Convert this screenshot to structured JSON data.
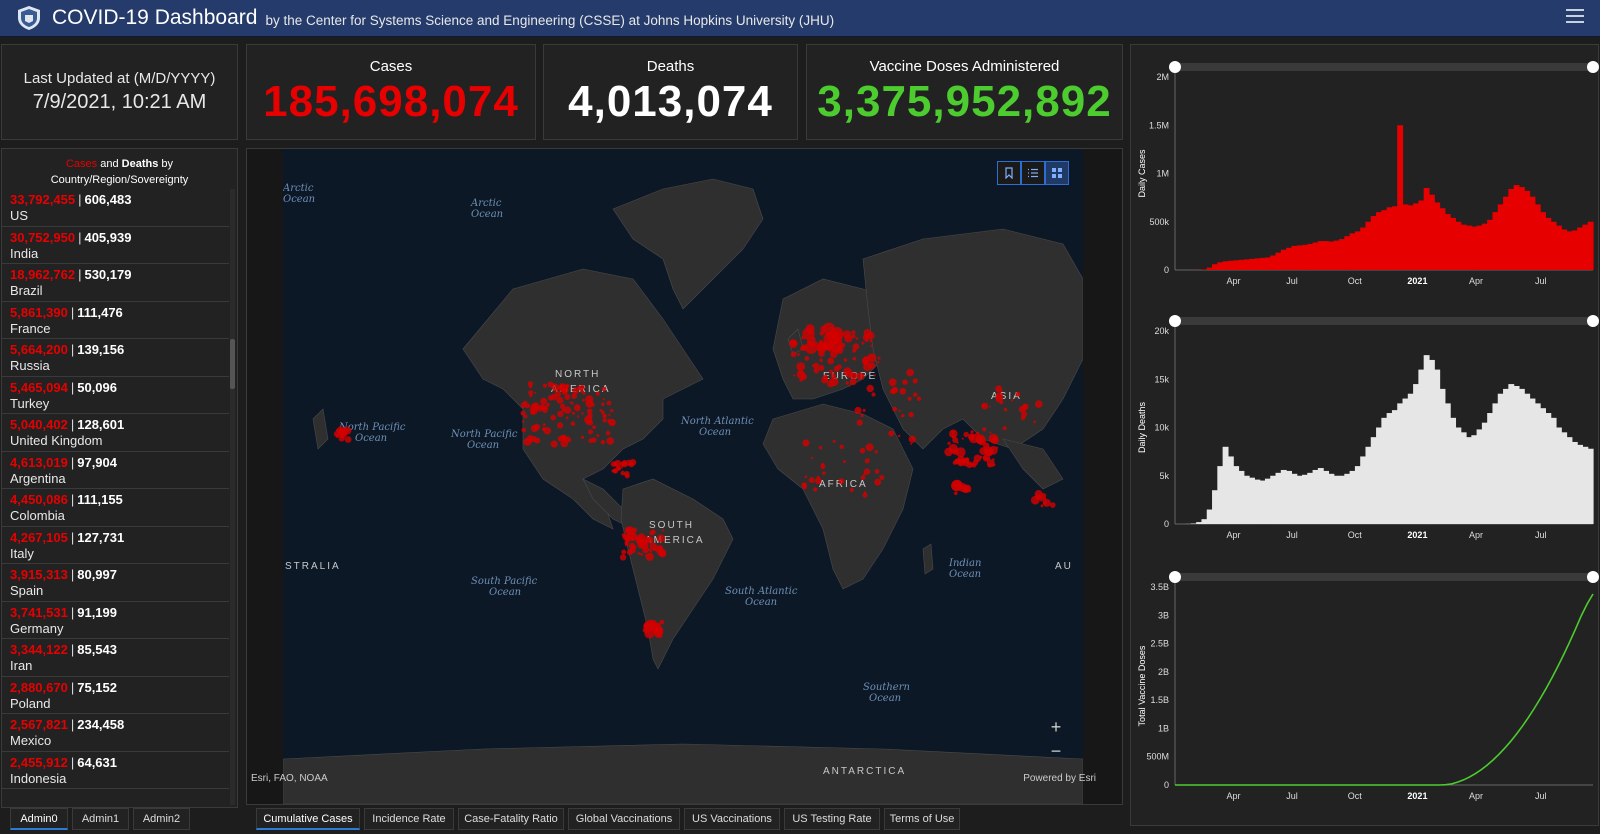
{
  "header": {
    "title": "COVID-19 Dashboard",
    "subtitle": "by the Center for Systems Science and Engineering (CSSE) at Johns Hopkins University (JHU)"
  },
  "last_updated": {
    "label": "Last Updated at (M/D/YYYY)",
    "value": "7/9/2021, 10:21 AM"
  },
  "stats": {
    "cases": {
      "label": "Cases",
      "value": "185,698,074",
      "color": "#e60000"
    },
    "deaths": {
      "label": "Deaths",
      "value": "4,013,074",
      "color": "#ffffff"
    },
    "vaccines": {
      "label": "Vaccine Doses Administered",
      "value": "3,375,952,892",
      "color": "#4ccc2e"
    }
  },
  "list": {
    "title_cases": "Cases",
    "title_and": "and",
    "title_deaths": "Deaths",
    "title_by": "by",
    "title_line2": "Country/Region/Sovereignty",
    "items": [
      {
        "cases": "33,792,455",
        "deaths": "606,483",
        "name": "US"
      },
      {
        "cases": "30,752,950",
        "deaths": "405,939",
        "name": "India"
      },
      {
        "cases": "18,962,762",
        "deaths": "530,179",
        "name": "Brazil"
      },
      {
        "cases": "5,861,390",
        "deaths": "111,476",
        "name": "France"
      },
      {
        "cases": "5,664,200",
        "deaths": "139,156",
        "name": "Russia"
      },
      {
        "cases": "5,465,094",
        "deaths": "50,096",
        "name": "Turkey"
      },
      {
        "cases": "5,040,402",
        "deaths": "128,601",
        "name": "United Kingdom"
      },
      {
        "cases": "4,613,019",
        "deaths": "97,904",
        "name": "Argentina"
      },
      {
        "cases": "4,450,086",
        "deaths": "111,155",
        "name": "Colombia"
      },
      {
        "cases": "4,267,105",
        "deaths": "127,731",
        "name": "Italy"
      },
      {
        "cases": "3,915,313",
        "deaths": "80,997",
        "name": "Spain"
      },
      {
        "cases": "3,741,531",
        "deaths": "91,199",
        "name": "Germany"
      },
      {
        "cases": "3,344,122",
        "deaths": "85,543",
        "name": "Iran"
      },
      {
        "cases": "2,880,670",
        "deaths": "75,152",
        "name": "Poland"
      },
      {
        "cases": "2,567,821",
        "deaths": "234,458",
        "name": "Mexico"
      },
      {
        "cases": "2,455,912",
        "deaths": "64,631",
        "name": "Indonesia"
      }
    ]
  },
  "map": {
    "attribution_left": "Esri, FAO, NOAA",
    "attribution_right": "Powered by Esri",
    "continents": [
      "NORTH",
      "AMERICA",
      "SOUTH",
      "AMERICA",
      "EUROPE",
      "ASIA",
      "AFRICA",
      "ANTARCTICA",
      "STRALIA",
      "AU"
    ],
    "oceans": {
      "arctic_left_1": "Arctic",
      "arctic_left_2": "Ocean",
      "arctic_mid_1": "Arctic",
      "arctic_mid_2": "Ocean",
      "npac1_1": "North Pacific",
      "npac1_2": "Ocean",
      "npac2_1": "North Pacific",
      "npac2_2": "Ocean",
      "natl_1": "North Atlantic",
      "natl_2": "Ocean",
      "spac_1": "South Pacific",
      "spac_2": "Ocean",
      "satl_1": "South Atlantic",
      "satl_2": "Ocean",
      "ind_1": "Indian",
      "ind_2": "Ocean",
      "south_1": "Southern",
      "south_2": "Ocean"
    },
    "zoom_in": "+",
    "zoom_out": "−"
  },
  "admin_tabs": [
    "Admin0",
    "Admin1",
    "Admin2"
  ],
  "map_tabs": [
    "Cumulative Cases",
    "Incidence Rate",
    "Case-Fatality Ratio",
    "Global Vaccinations",
    "US Vaccinations",
    "US Testing Rate",
    "Terms of Use"
  ],
  "colors": {
    "header_bg": "#243b6b",
    "accent_blue": "#2b7bd8",
    "case_red": "#e60000",
    "vaccine_green": "#4ccc2e"
  },
  "chart_data": [
    {
      "type": "bar",
      "ylabel": "Daily Cases",
      "yticks": [
        "2M",
        "1.5M",
        "1M",
        "500k",
        "0"
      ],
      "ylim": [
        0,
        2000000
      ],
      "xticks": [
        "Apr",
        "Jul",
        "Oct",
        "2021",
        "Apr",
        "Jul"
      ],
      "color": "#e60000",
      "series": [
        {
          "values": [
            0,
            0,
            0,
            500,
            1500,
            5000,
            25000,
            60000,
            80000,
            90000,
            95000,
            100000,
            105000,
            110000,
            115000,
            120000,
            125000,
            130000,
            150000,
            180000,
            210000,
            230000,
            250000,
            255000,
            260000,
            270000,
            285000,
            300000,
            300000,
            295000,
            305000,
            320000,
            350000,
            380000,
            400000,
            440000,
            500000,
            560000,
            600000,
            620000,
            650000,
            660000,
            1500000,
            680000,
            670000,
            690000,
            720000,
            850000,
            780000,
            700000,
            640000,
            580000,
            540000,
            500000,
            470000,
            460000,
            450000,
            460000,
            480000,
            520000,
            600000,
            680000,
            760000,
            840000,
            880000,
            860000,
            820000,
            760000,
            680000,
            600000,
            540000,
            500000,
            460000,
            420000,
            400000,
            410000,
            440000,
            470000,
            500000
          ]
        }
      ]
    },
    {
      "type": "bar",
      "ylabel": "Daily Deaths",
      "yticks": [
        "20k",
        "15k",
        "10k",
        "5k",
        "0"
      ],
      "ylim": [
        0,
        20000
      ],
      "xticks": [
        "Apr",
        "Jul",
        "Oct",
        "2021",
        "Apr",
        "Jul"
      ],
      "color": "#e6e6e6",
      "series": [
        {
          "values": [
            0,
            0,
            10,
            50,
            200,
            500,
            1500,
            3500,
            6000,
            8000,
            7000,
            6000,
            5500,
            5000,
            4800,
            4600,
            4500,
            4700,
            5000,
            5300,
            5600,
            5500,
            5200,
            5000,
            5100,
            5300,
            5600,
            5800,
            5500,
            5200,
            5000,
            5000,
            5200,
            5500,
            6000,
            7000,
            8000,
            9000,
            10000,
            11000,
            11500,
            11800,
            12500,
            13000,
            13500,
            14500,
            16000,
            17500,
            17000,
            16000,
            14000,
            12500,
            11000,
            10000,
            9500,
            9000,
            9200,
            9800,
            10500,
            11500,
            12500,
            13500,
            14000,
            14500,
            14300,
            14000,
            13500,
            13000,
            12500,
            12000,
            11500,
            11000,
            10000,
            9500,
            9000,
            8500,
            8200,
            8000,
            7800
          ]
        }
      ]
    },
    {
      "type": "line",
      "ylabel": "Total Vaccine Doses",
      "yticks": [
        "3.5B",
        "3B",
        "2.5B",
        "2B",
        "1.5B",
        "1B",
        "500M",
        "0"
      ],
      "ylim": [
        0,
        3500000000
      ],
      "xticks": [
        "Apr",
        "Jul",
        "Oct",
        "2021",
        "Apr",
        "Jul"
      ],
      "color": "#4ccc2e",
      "series": [
        {
          "values": [
            0,
            0,
            0,
            0,
            0,
            0,
            0,
            0,
            0,
            0,
            0,
            0,
            0,
            0,
            0,
            0,
            0,
            0,
            0,
            0,
            0,
            0,
            0,
            0,
            0,
            0,
            0,
            0,
            0,
            0,
            0,
            0,
            0,
            0,
            0,
            0,
            0,
            0,
            0,
            0,
            0,
            0,
            0,
            0,
            0,
            0,
            5000000,
            20000000,
            50000000,
            90000000,
            140000000,
            200000000,
            270000000,
            350000000,
            440000000,
            540000000,
            650000000,
            770000000,
            900000000,
            1040000000,
            1190000000,
            1350000000,
            1520000000,
            1700000000,
            1890000000,
            2090000000,
            2300000000,
            2520000000,
            2750000000,
            2990000000,
            3200000000,
            3375952892
          ]
        }
      ]
    }
  ]
}
